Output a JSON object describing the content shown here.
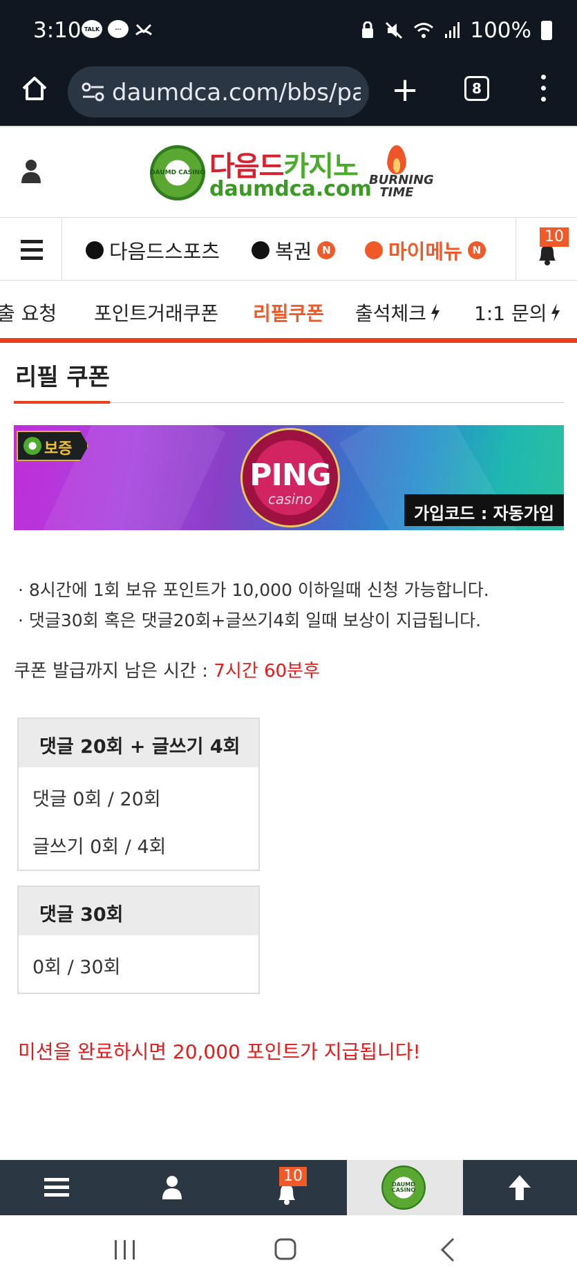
{
  "status_bar": {
    "time": "3:10",
    "talk_label": "TALK",
    "battery": "100%"
  },
  "browser": {
    "url": "daumdca.com/bbs/page",
    "tab_count": "8"
  },
  "site": {
    "logo_kr_red": "다음드",
    "logo_kr_green": "카지노",
    "logo_en": "daumdca.com",
    "logo_badge": "DAUMD CASINO",
    "burning_time": "BURNING TIME"
  },
  "main_nav": {
    "items": [
      {
        "label": "다음드스포츠"
      },
      {
        "label": "복권",
        "badge": "N"
      },
      {
        "label": "마이메뉴",
        "badge": "N"
      }
    ],
    "notification_count": "10"
  },
  "sub_nav": {
    "items": [
      {
        "label": "출 요청"
      },
      {
        "label": "포인트거래쿠폰"
      },
      {
        "label": "리필쿠폰"
      },
      {
        "label": "출석체크"
      },
      {
        "label": "1:1 문의"
      }
    ]
  },
  "page": {
    "title": "리필 쿠폰"
  },
  "banner": {
    "warranty": "보증",
    "brand": "PING",
    "brand_sub": "casino",
    "join_code": "가입코드 : 자동가입"
  },
  "info": {
    "lines": [
      "· 8시간에 1회 보유 포인트가 10,000 이하일때 신청 가능합니다.",
      "· 댓글30회 혹은 댓글20회+글쓰기4회 일때 보상이 지급됩니다."
    ],
    "remain_label": "쿠폰 발급까지 남은 시간 : ",
    "remain_value": "7시간 60분후"
  },
  "missions": [
    {
      "header": "댓글 20회 + 글쓰기 4회",
      "rows": [
        "댓글 0회 / 20회",
        "글쓰기 0회 / 4회"
      ]
    },
    {
      "header": "댓글 30회",
      "rows": [
        "0회 / 30회"
      ]
    }
  ],
  "final_message": "미션을 완료하시면 20,000 포인트가 지급됩니다!",
  "bottom_bar": {
    "notification_count": "10",
    "logo_text": "DAUMD CASINO"
  },
  "colors": {
    "accent": "#f05a28",
    "red_text": "#e31b1b",
    "dark_bar": "#2c3744",
    "status_bg": "#101720"
  }
}
